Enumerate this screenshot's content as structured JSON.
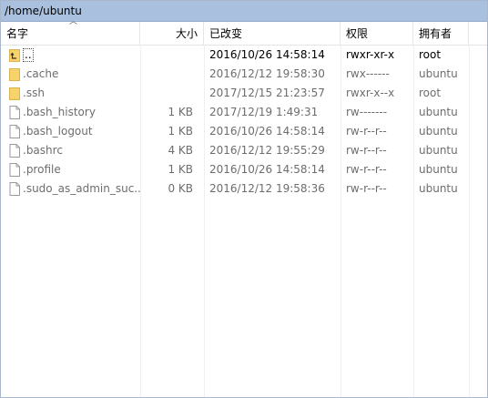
{
  "path": "/home/ubuntu",
  "columns": {
    "name": "名字",
    "size": "大小",
    "modified": "已改变",
    "permissions": "权限",
    "owner": "拥有者"
  },
  "files": [
    {
      "name": "..",
      "size": "",
      "modified": "2016/10/26 14:58:14",
      "permissions": "rwxr-xr-x",
      "owner": "root",
      "type": "parent",
      "icon": "parent-folder-icon"
    },
    {
      "name": ".cache",
      "size": "",
      "modified": "2016/12/12 19:58:30",
      "permissions": "rwx------",
      "owner": "ubuntu",
      "type": "folder",
      "icon": "folder-icon"
    },
    {
      "name": ".ssh",
      "size": "",
      "modified": "2017/12/15 21:23:57",
      "permissions": "rwxr-x--x",
      "owner": "root",
      "type": "folder",
      "icon": "folder-icon"
    },
    {
      "name": ".bash_history",
      "size": "1 KB",
      "modified": "2017/12/19 1:49:31",
      "permissions": "rw-------",
      "owner": "ubuntu",
      "type": "file",
      "icon": "file-icon"
    },
    {
      "name": ".bash_logout",
      "size": "1 KB",
      "modified": "2016/10/26 14:58:14",
      "permissions": "rw-r--r--",
      "owner": "ubuntu",
      "type": "file",
      "icon": "file-icon"
    },
    {
      "name": ".bashrc",
      "size": "4 KB",
      "modified": "2016/12/12 19:55:29",
      "permissions": "rw-r--r--",
      "owner": "ubuntu",
      "type": "file",
      "icon": "file-icon"
    },
    {
      "name": ".profile",
      "size": "1 KB",
      "modified": "2016/10/26 14:58:14",
      "permissions": "rw-r--r--",
      "owner": "ubuntu",
      "type": "file",
      "icon": "file-icon"
    },
    {
      "name": ".sudo_as_admin_suc...",
      "size": "0 KB",
      "modified": "2016/12/12 19:58:36",
      "permissions": "rw-r--r--",
      "owner": "ubuntu",
      "type": "file",
      "icon": "file-icon"
    }
  ],
  "colors": {
    "pathbar": "#a9c1de",
    "folder": "#f6d36b",
    "muted_text": "#6d6d6d"
  }
}
